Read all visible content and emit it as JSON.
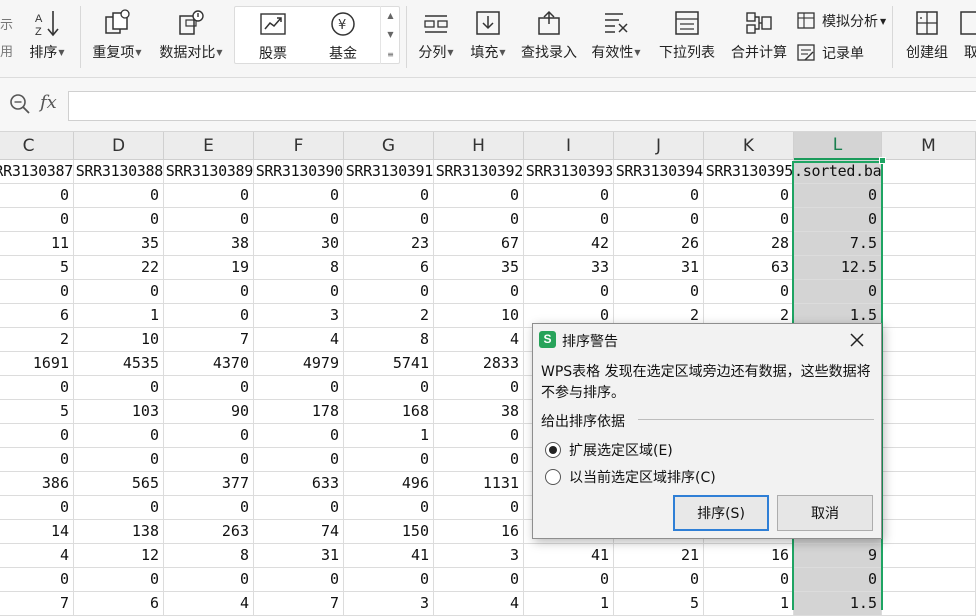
{
  "ribbon": {
    "left_edge": [
      "示",
      "用"
    ],
    "buttons": [
      {
        "id": "sort",
        "label": "排序",
        "dropdown": true,
        "icon": "sort-icon"
      },
      {
        "id": "duplicates",
        "label": "重复项",
        "dropdown": true,
        "icon": "duplicates-icon"
      },
      {
        "id": "compare",
        "label": "数据对比",
        "dropdown": true,
        "icon": "data-compare-icon"
      },
      {
        "id": "stock",
        "label": "股票",
        "dropdown": false,
        "icon": "stock-chart-icon"
      },
      {
        "id": "fund",
        "label": "基金",
        "dropdown": false,
        "icon": "yen-icon"
      },
      {
        "id": "split",
        "label": "分列",
        "dropdown": true,
        "icon": "split-columns-icon"
      },
      {
        "id": "fill",
        "label": "填充",
        "dropdown": true,
        "icon": "fill-down-icon"
      },
      {
        "id": "lookup",
        "label": "查找录入",
        "dropdown": false,
        "icon": "lookup-entry-icon"
      },
      {
        "id": "validity",
        "label": "有效性",
        "dropdown": true,
        "icon": "validation-icon"
      },
      {
        "id": "dropdown_list",
        "label": "下拉列表",
        "dropdown": false,
        "icon": "dropdown-list-icon"
      },
      {
        "id": "consolidate",
        "label": "合并计算",
        "dropdown": false,
        "icon": "consolidate-icon"
      },
      {
        "id": "group",
        "label": "创建组",
        "dropdown": false,
        "icon": "create-group-icon"
      },
      {
        "id": "ungroup",
        "label": "取",
        "dropdown": false,
        "icon": "ungroup-icon"
      }
    ],
    "small_buttons": [
      {
        "id": "what_if",
        "label": "模拟分析",
        "dropdown": true,
        "icon": "what-if-icon"
      },
      {
        "id": "record",
        "label": "记录单",
        "dropdown": false,
        "icon": "record-form-icon"
      }
    ],
    "scroll_glyphs": [
      "▲",
      "▼",
      "≡"
    ]
  },
  "formula_bar": {
    "fx_label": "fx",
    "value": ""
  },
  "sheet": {
    "columns": [
      "C",
      "D",
      "E",
      "F",
      "G",
      "H",
      "I",
      "J",
      "K",
      "L",
      "M"
    ],
    "selected_column": "L",
    "header_row": [
      "SRR3130387",
      "SRR3130388",
      "SRR3130389",
      "SRR3130390",
      "SRR3130391",
      "SRR3130392",
      "SRR3130393",
      "SRR3130394",
      "SRR3130395",
      ".sorted.bam",
      ""
    ],
    "rows": [
      [
        "0",
        "0",
        "0",
        "0",
        "0",
        "0",
        "0",
        "0",
        "0",
        "0",
        ""
      ],
      [
        "0",
        "0",
        "0",
        "0",
        "0",
        "0",
        "0",
        "0",
        "0",
        "0",
        ""
      ],
      [
        "11",
        "35",
        "38",
        "30",
        "23",
        "67",
        "42",
        "26",
        "28",
        "7.5",
        ""
      ],
      [
        "5",
        "22",
        "19",
        "8",
        "6",
        "35",
        "33",
        "31",
        "63",
        "12.5",
        ""
      ],
      [
        "0",
        "0",
        "0",
        "0",
        "0",
        "0",
        "0",
        "0",
        "0",
        "0",
        ""
      ],
      [
        "6",
        "1",
        "0",
        "3",
        "2",
        "10",
        "0",
        "2",
        "2",
        "1.5",
        ""
      ],
      [
        "2",
        "10",
        "7",
        "4",
        "8",
        "4",
        "",
        "",
        "",
        "",
        ""
      ],
      [
        "1691",
        "4535",
        "4370",
        "4979",
        "5741",
        "2833",
        "",
        "",
        "",
        "",
        ""
      ],
      [
        "0",
        "0",
        "0",
        "0",
        "0",
        "0",
        "",
        "",
        "",
        "",
        ""
      ],
      [
        "5",
        "103",
        "90",
        "178",
        "168",
        "38",
        "",
        "",
        "",
        "",
        ""
      ],
      [
        "0",
        "0",
        "0",
        "0",
        "1",
        "0",
        "",
        "",
        "",
        "",
        ""
      ],
      [
        "0",
        "0",
        "0",
        "0",
        "0",
        "0",
        "",
        "",
        "",
        "",
        ""
      ],
      [
        "386",
        "565",
        "377",
        "633",
        "496",
        "1131",
        "",
        "",
        "",
        "",
        ""
      ],
      [
        "0",
        "0",
        "0",
        "0",
        "0",
        "0",
        "",
        "",
        "",
        "",
        ""
      ],
      [
        "14",
        "138",
        "263",
        "74",
        "150",
        "16",
        "",
        "",
        "",
        "",
        ""
      ],
      [
        "4",
        "12",
        "8",
        "31",
        "41",
        "3",
        "41",
        "21",
        "16",
        "9",
        ""
      ],
      [
        "0",
        "0",
        "0",
        "0",
        "0",
        "0",
        "0",
        "0",
        "0",
        "0",
        ""
      ],
      [
        "7",
        "6",
        "4",
        "7",
        "3",
        "4",
        "1",
        "5",
        "1",
        "1.5",
        ""
      ]
    ]
  },
  "dialog": {
    "title": "排序警告",
    "app_icon": "S",
    "message": "WPS表格 发现在选定区域旁边还有数据，这些数据将不参与排序。",
    "group_label": "给出排序依据",
    "options": [
      {
        "label": "扩展选定区域(E)",
        "selected": true
      },
      {
        "label": "以当前选定区域排序(C)",
        "selected": false
      }
    ],
    "sort_button": "排序(S)",
    "cancel_button": "取消"
  },
  "colors": {
    "selection_border": "#1fa463",
    "selected_column_fill": "#d4d4d4",
    "primary_button_border": "#2f7fd6",
    "wps_icon": "#27a35a"
  }
}
